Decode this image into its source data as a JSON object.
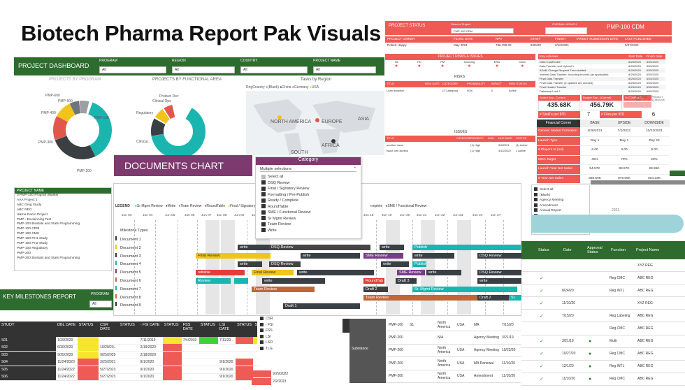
{
  "title": "Biotech Pharma Report Pak Visuals",
  "dashboard": {
    "header": "PROJECT DASHBOARD",
    "filters": [
      {
        "label": "PROGRAM",
        "value": "All"
      },
      {
        "label": "REGION",
        "value": "All"
      },
      {
        "label": "COUNTRY",
        "value": "All"
      },
      {
        "label": "PROJECT NAME",
        "value": "All"
      }
    ],
    "donut1_title": "PROJECTS BY PROGRAM",
    "donut1_labels": [
      "PMP-600",
      "PMP-500",
      "PMP-400",
      "PMP-300",
      "PMP-100",
      "PMP-200"
    ],
    "donut2_title": "PROJECTS BY FUNCTIONAL AREA",
    "donut2_labels": [
      "Product Dev",
      "Clinical Ops",
      "Regulatory",
      "Clinical..."
    ],
    "map_title": "Tasks by Region",
    "map_legend_label": "RegCountry",
    "map_legend": [
      "(Blank)",
      "China",
      "Germany",
      "USA"
    ],
    "map_labels": [
      "NORTH AMERICA",
      "EUROPE",
      "ASIA",
      "AFRICA",
      "SOUTH"
    ],
    "project_list_header": "PROJECT NAME",
    "project_list": [
      "0 PMP-100 Program Master",
      "AAA Project 1",
      "ABC Drug Study",
      "ABC REG",
      "Hikma Demo Project",
      "PMP - Envisioning Test",
      "PMP-100 Biostats and Stats Programming",
      "PMP-100 CDM",
      "PMP-100 CMC",
      "PMP-100 PH1 Study",
      "PMP-100 PH2 Study",
      "PMP-100 Regulatory",
      "PMP-200",
      "PMP-200 Biostats and Stats Programming"
    ]
  },
  "status": {
    "header": "PROJECT STATUS",
    "select_label": "Select a Project",
    "select_value": "PMP-100 CDM",
    "health_label": "OVERALL HEALTH",
    "project_title": "PMP-100 CDM",
    "cols": [
      "PROJECT OWNER",
      "FILING DATE",
      "NPV",
      "START",
      "FINISH",
      "TARGET SUBMISSION DATE",
      "LAST PUBLISHED"
    ],
    "row": [
      "Robert Happy",
      "May 2021",
      "786,789.00",
      "8/25/20",
      "2/10/2021",
      "",
      "9/27/2021"
    ],
    "risks_header": "PROJECT RISKS & ISSUES",
    "risk_cats": [
      "Hit",
      "PD",
      "PM",
      "Sourcing",
      "ERA",
      "Clinic"
    ],
    "risks_title": "RISKS",
    "risk_cols": [
      "TITLE",
      "RISK DATE",
      "CATEGORY",
      "PROBABILITY",
      "IMPACT",
      "RISK STATUS"
    ],
    "risk_row": [
      "Loan adoption",
      "",
      "(2 Category)",
      "50%",
      "0",
      "Active"
    ],
    "issues_title": "ISSUES",
    "issue_cols": [
      "TITLE",
      "CATEGORY",
      "PRIORITY",
      "LINK",
      "DUE DATE",
      "STATUS"
    ],
    "issue_rows": [
      [
        "another issue",
        "",
        "(1) High",
        "",
        "9/6/2021",
        "(1) Active"
      ],
      [
        "Issue one access",
        "",
        "(1) High",
        "",
        "4/14/2022",
        "1 Active"
      ]
    ],
    "activities_cols": [
      "Key Activities",
      "Start Date",
      "Finish Date"
    ],
    "activities": [
      [
        "Data Cutoff Date",
        "8/25/2020",
        "8/25/2020"
      ],
      [
        "Data Transfer and Upload 1",
        "8/25/2020",
        "8/25/2020"
      ],
      [
        "ADaM Change Request Form drafted",
        "8/25/2020",
        "8/25/2020"
      ],
      [
        "Internal Data Transfer: Including records (as applicable)",
        "8/25/2020",
        "8/25/2020"
      ],
      [
        "Final Data Transfer",
        "8/25/2020",
        "8/25/2020"
      ],
      [
        "Final Data Transfer (if updates are needed)",
        "8/25/2020",
        "8/25/2020"
      ],
      [
        "Final Header Transfer",
        "8/25/2020",
        "8/25/2020"
      ],
      [
        "Database Lock 1",
        "8/25/2020",
        "8/25/2020"
      ]
    ],
    "kpis": [
      {
        "label": "Added Sep - Current",
        "value": "435.68K"
      },
      {
        "label": "Budget Sep - (Current)",
        "value": "456.79K"
      },
      {
        "label": "% COMPLETE",
        "value": ""
      },
      {
        "label": "# StaR's per IPD",
        "value": "7"
      },
      {
        "label": "# Files per IPD",
        "value": "6"
      }
    ],
    "kpi_small": [
      "PROJECT STE",
      "PROJECT SCHEDULE"
    ]
  },
  "financial": {
    "cols": [
      "Financial Corner",
      "BASE",
      "UPSIDE",
      "DOWNSIDE"
    ],
    "rows": [
      [
        "Generic Market Formation",
        "4/26/2021",
        "7/1/2021",
        "10/22/2021"
      ],
      [
        "Launch Type",
        "Day 1",
        "Day 1",
        "Day 20"
      ],
      [
        "# Players or (mil)",
        "6.00",
        "3.00",
        "9.00"
      ],
      [
        "MOA Target",
        "40%",
        "70%",
        "20%"
      ],
      [
        "Launch Year Net Sales",
        "54.57K",
        "98.57K",
        "28.95K"
      ],
      [
        "5 Year Net Sales",
        "868.59K",
        "979.65K",
        "604.33K"
      ]
    ]
  },
  "documents": {
    "banner": "DOCUMENTS CHART",
    "category_title": "Category",
    "category_sub": "Multiple selections",
    "category_items": [
      "Select all",
      "DSQ Review",
      "Final / Signatory Review",
      "Formatting / Pre-Publish",
      "Ready / Complete",
      "RoundTable",
      "SME / Functional Review",
      "Sr Mgmt Review",
      "Team Review",
      "Write"
    ],
    "legend_label": "LEGEND",
    "legend": [
      {
        "name": "Sr Mgmt Review",
        "color": "#1bb5b0"
      },
      {
        "name": "Write",
        "color": "#333333"
      },
      {
        "name": "Team Review",
        "color": "#c0673a"
      },
      {
        "name": "RoundTable",
        "color": "#e23c3c"
      },
      {
        "name": "Final / Signatory",
        "color": "#f2c318"
      },
      {
        "name": "mplete",
        "color": "#888888"
      },
      {
        "name": "SME / Functional Review",
        "color": "#7a3a8a"
      }
    ],
    "dates_left": [
      "Jun 03",
      "Jun 04",
      "Jun 05",
      "Jun 06",
      "Jun 07",
      "Jun 08",
      "Jun 09",
      "Jun 10"
    ],
    "dates_right": [
      "Jun 18",
      "Jun 19",
      "Jun 20",
      "Jun 21",
      "Jun 22",
      "Jun 23",
      "Jun 24",
      "Jun 27"
    ],
    "milestone_label": "Milestone Types",
    "docs": [
      "Document 1",
      "Document 2",
      "Document 3",
      "Document 4",
      "Document 5",
      "Document 6",
      "Document 7",
      "Document 8",
      "Document 9"
    ],
    "bars": {
      "write": "write",
      "dsq": "DSQ Review",
      "publish": "Publish",
      "final": "Final Review",
      "sme": "SME Review",
      "review": "Review",
      "team": "Team Review",
      "round": "RoundTab",
      "draft3": "Draft 3",
      "ndtable": "ndtable",
      "srmgmt": "Sr. Mgmt Review",
      "draft2": "Draft 2",
      "draft1": "Draft 1",
      "sr": "Sr."
    }
  },
  "right_filter": {
    "items": [
      "Select all",
      "(Blank)",
      "Agency Meeting",
      "Amendment",
      "Annual Report",
      "CSR",
      "Internal Meetings",
      "MA",
      "MA Renewal"
    ],
    "year": "2021"
  },
  "milestones": {
    "header": "KEY MILESTONES REPORT",
    "program_label": "PROGRAM",
    "program_value": "All",
    "cols": [
      "STUDY",
      "DBL DATE",
      "STATUS",
      "CSR DATE",
      "STATUS",
      "- FSI DATE",
      "STATUS",
      "FSS DATE",
      "STATUS",
      "LSI DATE",
      "STATUS",
      "S"
    ],
    "rows": [
      [
        "S01",
        "1/29/2020",
        "",
        "",
        "",
        "7/11/2019",
        "",
        "7/4/2019",
        "",
        "7/11/20..",
        ""
      ],
      [
        "S02",
        "6/30/2020",
        "",
        "10/29/20..",
        "",
        "2/19/2020",
        "",
        "",
        "",
        "",
        ""
      ],
      [
        "S03",
        "9/25/2020",
        "",
        "9/25/2020",
        "",
        "2/18/2020",
        "",
        "",
        "",
        "",
        ""
      ],
      [
        "S04",
        "11/24/2020",
        "",
        "3/25/2021",
        "",
        "9/1/2020",
        "",
        "",
        "",
        "9/1/2020",
        ""
      ],
      [
        "S05",
        "11/24/2022",
        "",
        "5/27/2023",
        "",
        "9/1/2020",
        "",
        "",
        "",
        "9/1/2020",
        ""
      ],
      [
        "S06",
        "11/24/2022",
        "",
        "5/27/2023",
        "",
        "9/1/2020",
        "",
        "",
        "",
        "9/1/2020",
        ""
      ]
    ],
    "filter_items": [
      "CSR",
      "- FSI",
      "FSS",
      "LSI",
      "LSO",
      "TLG"
    ],
    "extra_dates": [
      "9/29/2022",
      "2/2/2023"
    ]
  },
  "regtable": {
    "cols": [
      "Status",
      "Date",
      "Approval Status",
      "Function",
      "Project Name"
    ],
    "rows": [
      [
        "",
        "",
        "",
        "",
        "XYZ REG"
      ],
      [
        "",
        "",
        "",
        "Reg CMC",
        "ABC REG"
      ],
      [
        "",
        "8/24/20",
        "",
        "Reg INTL",
        "ABC REG"
      ],
      [
        "",
        "11/10/20",
        "",
        "",
        "XYZ REG"
      ],
      [
        "",
        "7/15/20",
        "",
        "Reg Labeling",
        "ABC REG"
      ],
      [
        "",
        "",
        "",
        "Reg CMC",
        "ABC REG"
      ],
      [
        "",
        "3/21/19",
        "",
        "Multi",
        "ABC REG"
      ],
      [
        "",
        "10/27/20",
        "",
        "Reg CMC",
        "ABC REG"
      ],
      [
        "",
        "12/1/20",
        "",
        "Reg INTL",
        "ABC REG"
      ],
      [
        "",
        "11/10/20",
        "",
        "Reg CMC",
        "ABC REG"
      ]
    ],
    "left_rows": [
      [
        "PMP-100",
        "S1",
        "North America",
        "USA",
        "MA",
        "7/15/20"
      ],
      [
        "PMP-200",
        "",
        "N/A",
        "",
        "Agency Meeting",
        "3/21/19"
      ],
      [
        "PMP-200",
        "",
        "North America",
        "USA",
        "Agency Meeting",
        "10/22/20"
      ],
      [
        "PMP-200",
        "",
        "North America",
        "USA",
        "MA Renewal",
        "11/10/20"
      ],
      [
        "PMP-200",
        "",
        "North America",
        "USA",
        "Amendment",
        "11/10/20"
      ]
    ],
    "substance_label": "Substance"
  }
}
